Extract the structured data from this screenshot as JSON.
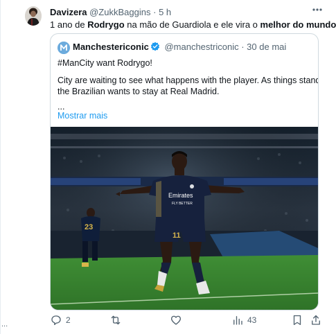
{
  "tweet": {
    "author_name": "Davizera",
    "author_handle": "@ZukkBaggins",
    "separator": "·",
    "time": "5 h",
    "text_parts": [
      "1 ano de ",
      "Rodrygo",
      " na mão de Guardiola e ele vira o ",
      "melhor do mundo"
    ]
  },
  "quote": {
    "author_name": "Manchestericonic",
    "author_handle": "@manchestriconic",
    "separator": "·",
    "date": "30 de mai",
    "lines": [
      "#ManCity want Rodrygo!",
      "City are waiting to see what happens with the player. As things stand,",
      "the Brazilian wants to stay at Real Madrid.",
      "..."
    ],
    "show_more": "Mostrar mais",
    "photo": {
      "shirt_text": "Emirates",
      "shirt_subtext": "FLY BETTER",
      "shorts_number": "11",
      "background_player_number": "23"
    }
  },
  "actions": {
    "reply_count": "2",
    "retweet_count": "",
    "like_count": "",
    "view_count": "43"
  },
  "left_ellipsis": "...",
  "colors": {
    "link": "#1d9bf0",
    "muted": "#536471",
    "border": "#cfd9de",
    "pitch": "#3d8a35"
  }
}
